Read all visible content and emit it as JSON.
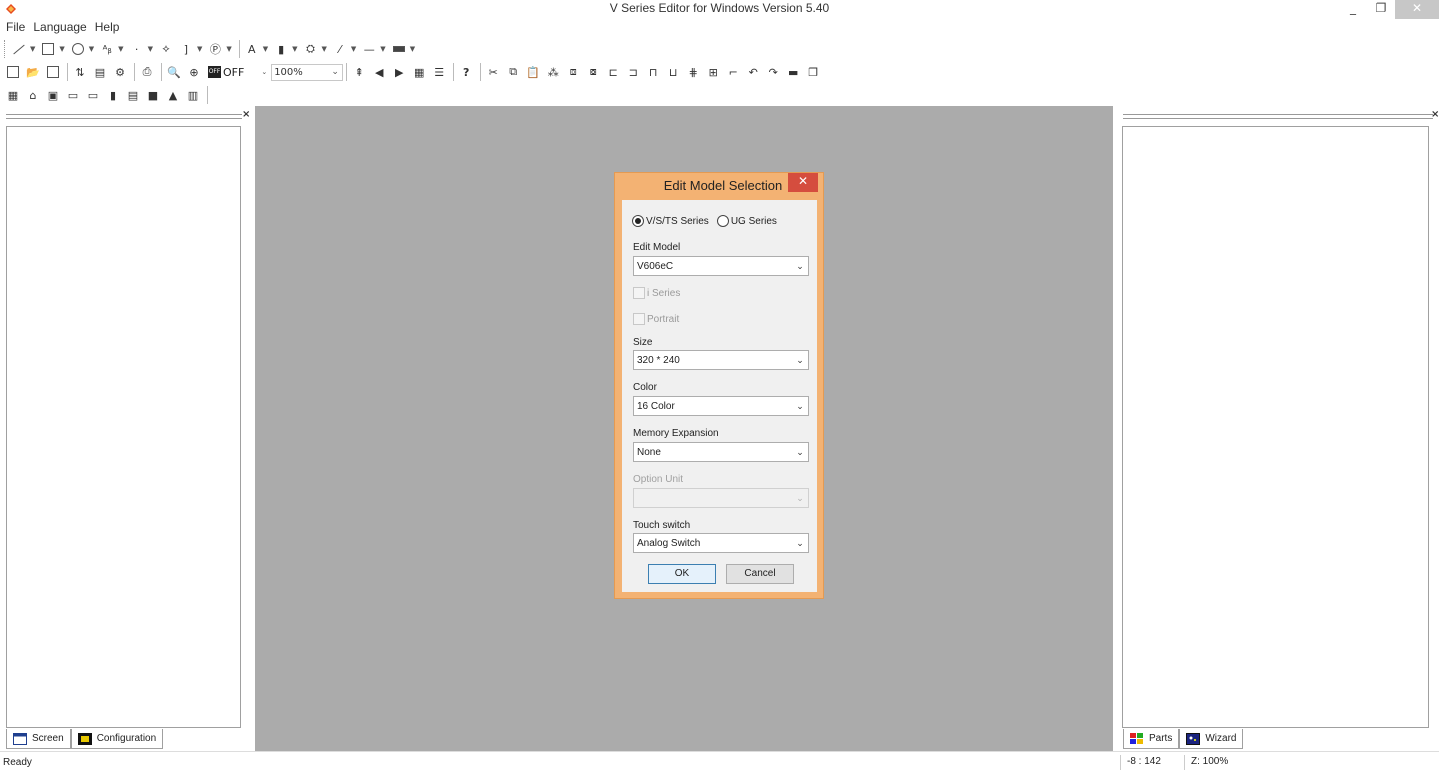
{
  "window": {
    "title": "V Series Editor for Windows Version 5.40",
    "min_glyph": "_",
    "max_glyph": "❐",
    "close_glyph": "✕"
  },
  "menu": [
    "File",
    "Language",
    "Help"
  ],
  "toolbar": {
    "draw_mode": "OFF",
    "draw_mode_indicator": "OFF",
    "zoom_value": "100%"
  },
  "left_panel": {
    "close_glyph": "×",
    "tabs": [
      {
        "label": "Screen",
        "icon": "screen-icon"
      },
      {
        "label": "Configuration",
        "icon": "configuration-icon"
      }
    ]
  },
  "right_panel": {
    "close_glyph": "×",
    "tabs": [
      {
        "label": "Parts",
        "icon": "parts-icon"
      },
      {
        "label": "Wizard",
        "icon": "wizard-icon"
      }
    ]
  },
  "dialog": {
    "title": "Edit Model Selection",
    "close_glyph": "✕",
    "series_options": [
      {
        "label": "V/S/TS Series",
        "selected": true
      },
      {
        "label": "UG Series",
        "selected": false
      }
    ],
    "edit_model_label": "Edit Model",
    "edit_model_value": "V606eC",
    "i_series_label": "i Series",
    "portrait_label": "Portrait",
    "size_label": "Size",
    "size_value": "320 * 240",
    "color_label": "Color",
    "color_value": "16 Color",
    "memory_label": "Memory Expansion",
    "memory_value": "None",
    "option_unit_label": "Option Unit",
    "option_unit_value": "",
    "touch_label": "Touch switch",
    "touch_value": "Analog Switch",
    "ok_label": "OK",
    "cancel_label": "Cancel"
  },
  "status": {
    "text": "Ready",
    "coords": "-8 : 142",
    "zoom": "Z: 100%"
  },
  "colors": {
    "workarea": "#ababab",
    "dialog_frame": "#f3b273",
    "dialog_close": "#d54d3e"
  }
}
